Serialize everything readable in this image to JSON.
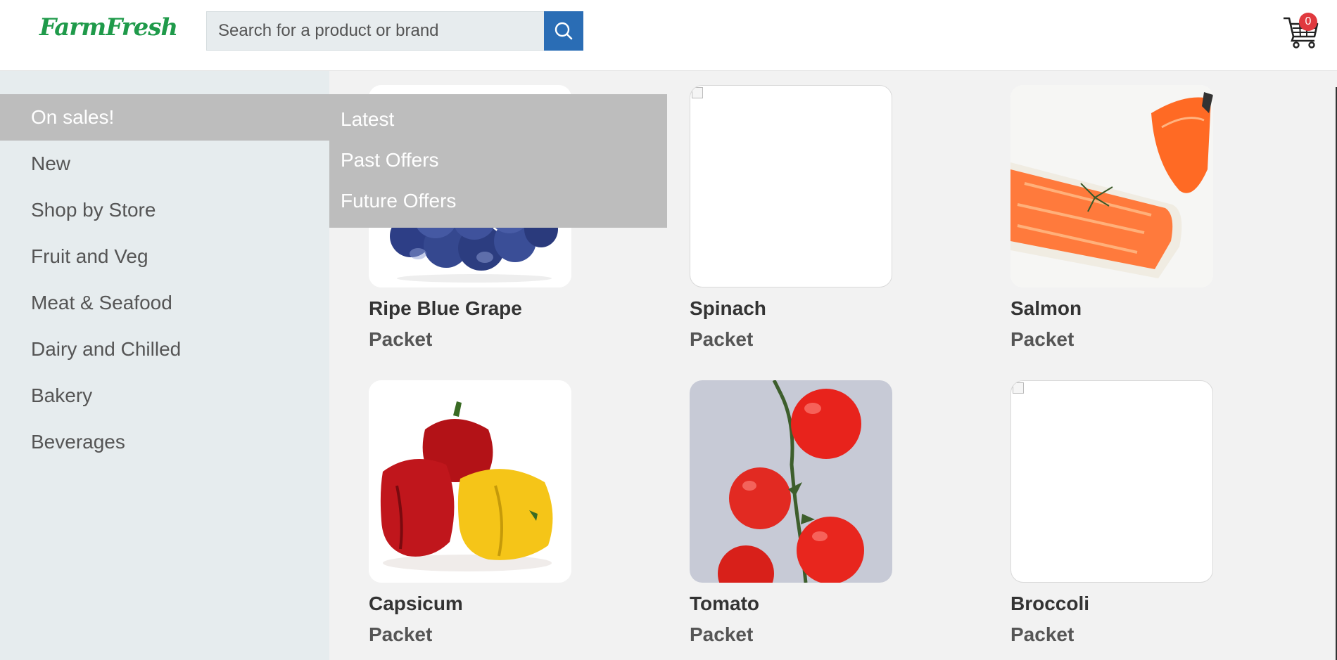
{
  "header": {
    "logo_text": "FarmFresh",
    "search_placeholder": "Search for a product or brand",
    "search_value": "",
    "cart_count": "0"
  },
  "sidebar": {
    "items": [
      {
        "label": "On sales!",
        "active": true
      },
      {
        "label": "New"
      },
      {
        "label": "Shop by Store"
      },
      {
        "label": "Fruit and Veg"
      },
      {
        "label": "Meat & Seafood"
      },
      {
        "label": "Dairy and Chilled"
      },
      {
        "label": "Bakery"
      },
      {
        "label": "Beverages"
      }
    ]
  },
  "submenu": {
    "items": [
      "Latest",
      "Past Offers",
      "Future Offers"
    ]
  },
  "products": [
    {
      "name": "Ripe Blue Grape",
      "unit": "Packet",
      "image": "blue-grapes"
    },
    {
      "name": "Spinach",
      "unit": "Packet",
      "image": "broken"
    },
    {
      "name": "Salmon",
      "unit": "Packet",
      "image": "salmon-fillets"
    },
    {
      "name": "Capsicum",
      "unit": "Packet",
      "image": "red-yellow-capsicum"
    },
    {
      "name": "Tomato",
      "unit": "Packet",
      "image": "cherry-tomatoes"
    },
    {
      "name": "Broccoli",
      "unit": "Packet",
      "image": "broken"
    }
  ],
  "colors": {
    "brand_green": "#1f9a4a",
    "search_button": "#2a6db5",
    "badge": "#e0393e",
    "active_menu": "#bdbdbd",
    "sidebar_bg": "#e6ecee"
  }
}
